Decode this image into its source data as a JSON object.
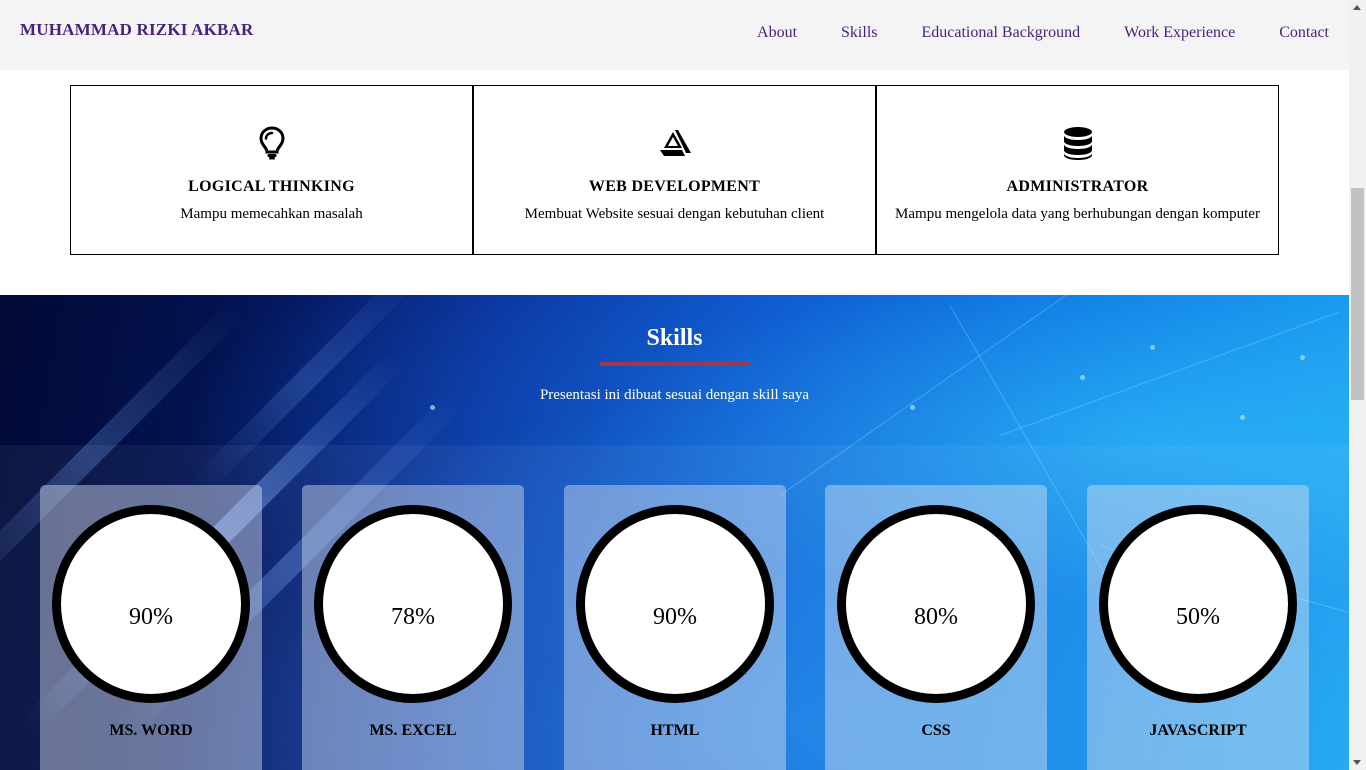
{
  "navbar": {
    "brand": "MUHAMMAD RIZKI AKBAR",
    "links": [
      "About",
      "Skills",
      "Educational Background",
      "Work Experience",
      "Contact"
    ]
  },
  "features": [
    {
      "icon": "lightbulb-icon",
      "title": "LOGICAL THINKING",
      "desc": "Mampu memecahkan masalah"
    },
    {
      "icon": "artstation-icon",
      "title": "WEB DEVELOPMENT",
      "desc": "Membuat Website sesuai dengan kebutuhan client"
    },
    {
      "icon": "database-icon",
      "title": "ADMINISTRATOR",
      "desc": "Mampu mengelola data yang berhubungan dengan komputer"
    }
  ],
  "skills": {
    "title": "Skills",
    "subtitle": "Presentasi ini dibuat sesuai dengan skill saya",
    "accent_color": "#9b3a4a",
    "items": [
      {
        "name": "MS. WORD",
        "percent": "90%"
      },
      {
        "name": "MS. EXCEL",
        "percent": "78%"
      },
      {
        "name": "HTML",
        "percent": "90%"
      },
      {
        "name": "CSS",
        "percent": "80%"
      },
      {
        "name": "JAVASCRIPT",
        "percent": "50%"
      }
    ]
  },
  "colors": {
    "brand": "#4b1f7a",
    "nav_bg": "#f4f4f4"
  }
}
